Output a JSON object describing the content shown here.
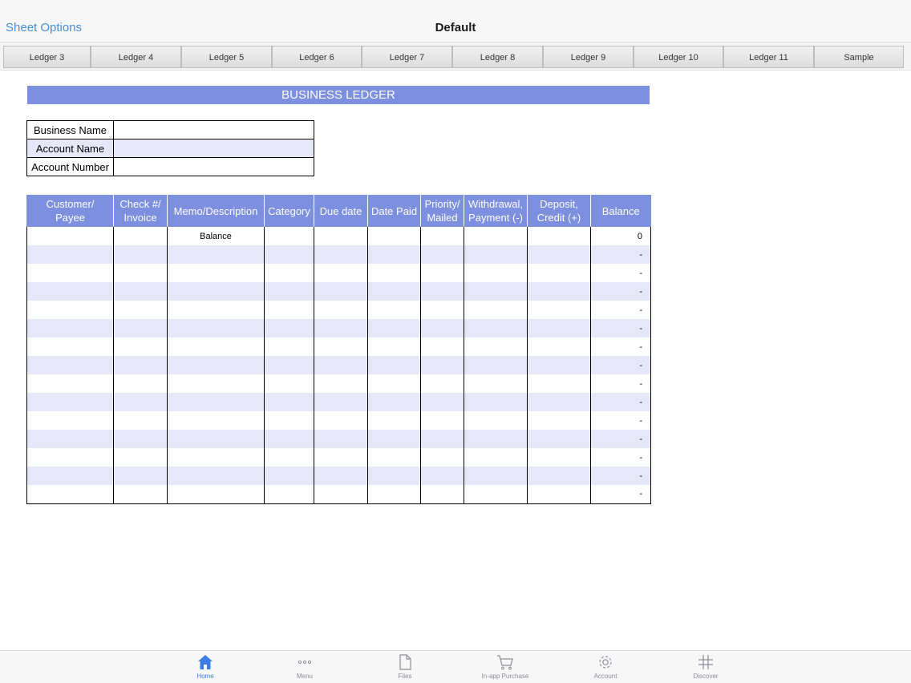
{
  "nav": {
    "left_label": "Sheet Options",
    "title": "Default"
  },
  "tabs": [
    "Ledger 3",
    "Ledger 4",
    "Ledger 5",
    "Ledger 6",
    "Ledger 7",
    "Ledger 8",
    "Ledger 9",
    "Ledger 10",
    "Ledger 11",
    "Sample"
  ],
  "sheet": {
    "banner": "BUSINESS LEDGER",
    "info_labels": [
      "Business Name",
      "Account Name",
      "Account Number"
    ],
    "columns": [
      {
        "line1": "Customer/",
        "line2": "Payee"
      },
      {
        "line1": "Check #/",
        "line2": "Invoice"
      },
      {
        "line1": "Memo/Description",
        "line2": ""
      },
      {
        "line1": "Category",
        "line2": ""
      },
      {
        "line1": "Due date",
        "line2": ""
      },
      {
        "line1": "Date Paid",
        "line2": ""
      },
      {
        "line1": "Priority/",
        "line2": "Mailed"
      },
      {
        "line1": "Withdrawal,",
        "line2": "Payment (-)"
      },
      {
        "line1": "Deposit,",
        "line2": "Credit (+)"
      },
      {
        "line1": "Balance",
        "line2": ""
      }
    ],
    "first_row_memo": "Balance",
    "balances": [
      "0",
      "-",
      "-",
      "-",
      "-",
      "-",
      "-",
      "-",
      "-",
      "-",
      "-",
      "-",
      "-",
      "-",
      "-"
    ]
  },
  "tabbar": [
    {
      "label": "Home",
      "icon": "home-icon",
      "active": true
    },
    {
      "label": "Menu",
      "icon": "more-icon",
      "active": false
    },
    {
      "label": "Files",
      "icon": "file-icon",
      "active": false
    },
    {
      "label": "In-app Purchase",
      "icon": "cart-icon",
      "active": false
    },
    {
      "label": "Account",
      "icon": "gear-icon",
      "active": false
    },
    {
      "label": "Discover",
      "icon": "hashtag-icon",
      "active": false
    }
  ],
  "colors": {
    "accent": "#7d8fdf",
    "row_alt": "#e6e8f8",
    "link": "#4a8fd8",
    "tab_active": "#3b7de0"
  }
}
